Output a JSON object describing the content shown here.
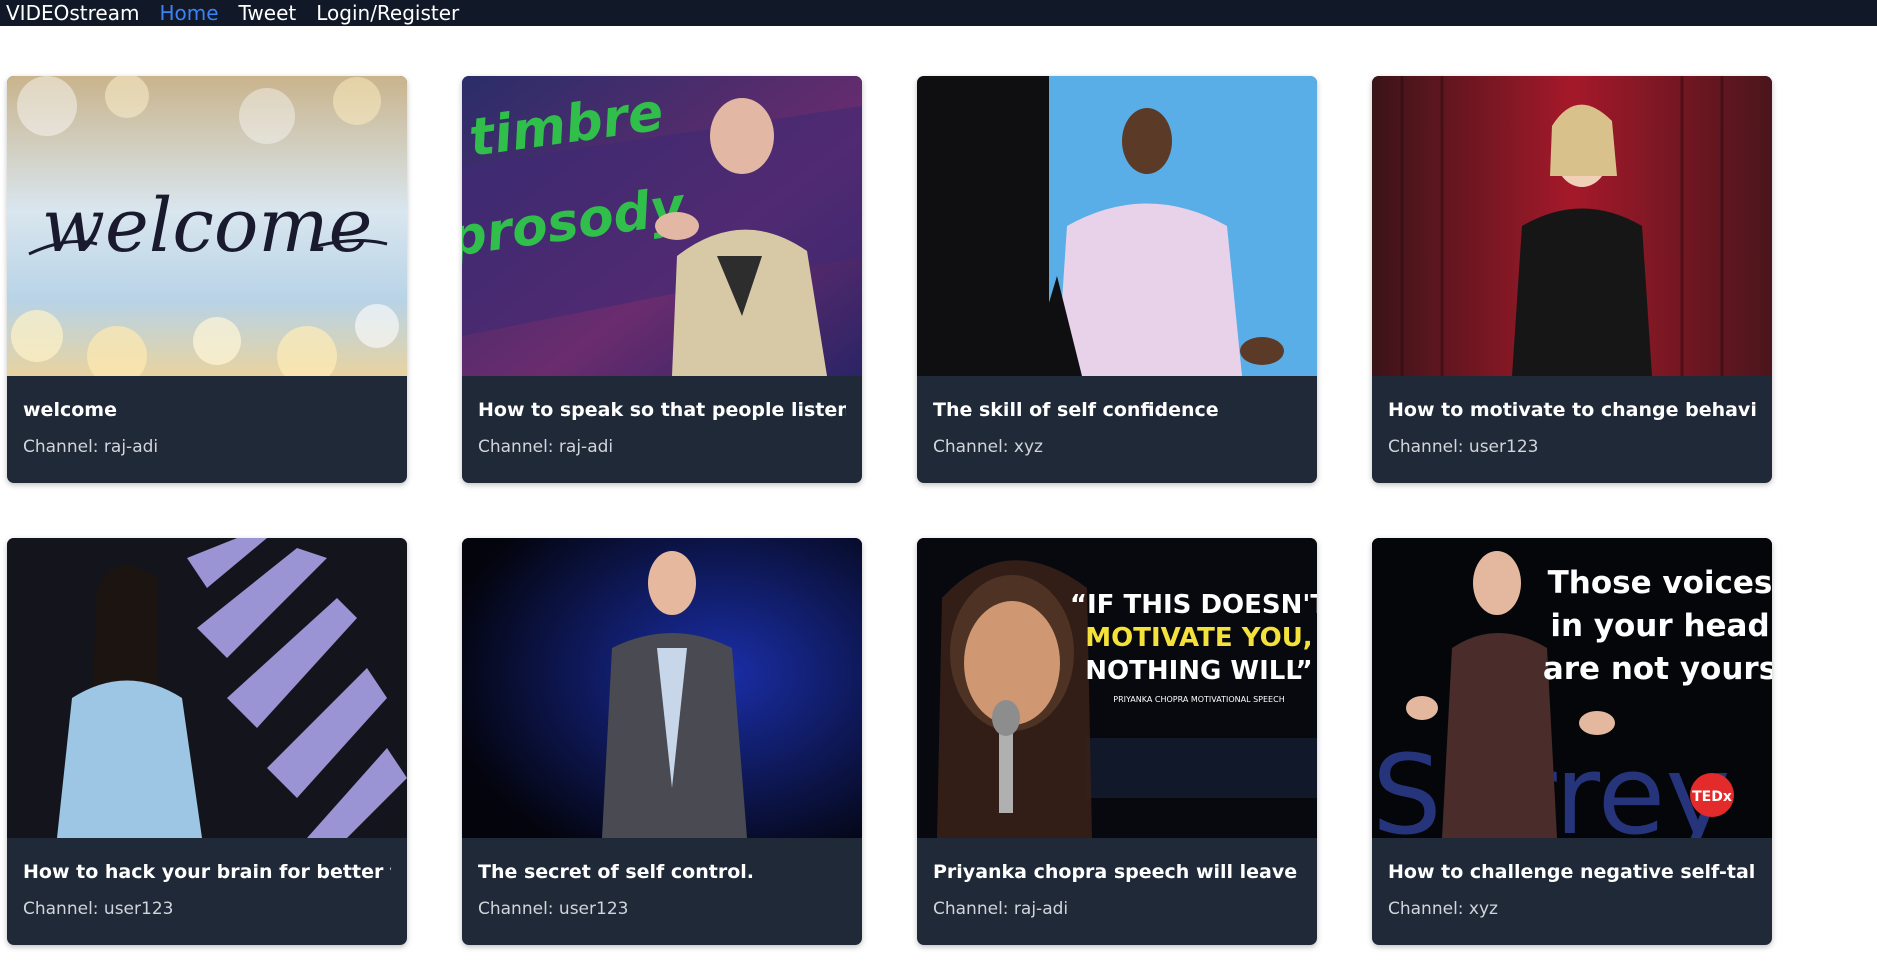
{
  "nav": {
    "brand": "VIDEOstream",
    "links": [
      {
        "label": "Home",
        "active": true
      },
      {
        "label": "Tweet",
        "active": false
      },
      {
        "label": "Login/Register",
        "active": false
      }
    ]
  },
  "videos": [
    {
      "title": "welcome",
      "channel": "Channel: raj-adi",
      "thumb_text": "welcome"
    },
    {
      "title": "How to speak so that people listen to ...",
      "channel": "Channel: raj-adi",
      "thumb_text": "timbre prosody"
    },
    {
      "title": "The skill of self confidence",
      "channel": "Channel: xyz"
    },
    {
      "title": "How to motivate to change behaviour.",
      "channel": "Channel: user123"
    },
    {
      "title": "How to hack your brain for better focus",
      "channel": "Channel: user123"
    },
    {
      "title": "The secret of self control.",
      "channel": "Channel: user123"
    },
    {
      "title": "Priyanka chopra speech will leave you ...",
      "channel": "Channel: raj-adi",
      "thumb_lines": [
        "“IF THIS DOESN'T",
        "MOTIVATE YOU,",
        "NOTHING WILL”"
      ],
      "thumb_sub": "PRIYANKA CHOPRA MOTIVATIONAL SPEECH"
    },
    {
      "title": "How to challenge negative self-talk",
      "channel": "Channel: xyz",
      "thumb_lines": [
        "Those voices",
        "in your head",
        "are not yours"
      ],
      "thumb_badge": "TEDx",
      "thumb_bg_word": "Surrey"
    }
  ],
  "colors": {
    "navbar": "#111827",
    "card": "#1f2937",
    "active_link": "#3b82f6"
  }
}
